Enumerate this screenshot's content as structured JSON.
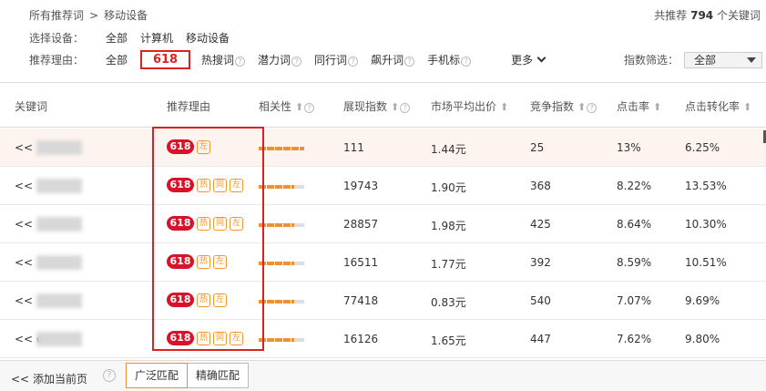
{
  "breadcrumb": {
    "root": "所有推荐词",
    "sep": ">",
    "current": "移动设备"
  },
  "total": {
    "prefix": "共推荐",
    "count": "794",
    "suffix": "个关键词"
  },
  "device": {
    "label": "选择设备：",
    "options": [
      "全部",
      "计算机",
      "移动设备"
    ]
  },
  "reason": {
    "label": "推荐理由：",
    "all": "全部",
    "selected": "618",
    "options": [
      "热搜词",
      "潜力词",
      "同行词",
      "飙升词",
      "手机标"
    ],
    "more": "更多"
  },
  "index_filter": {
    "label": "指数筛选：",
    "value": "全部"
  },
  "columns": [
    "关键词",
    "推荐理由",
    "相关性",
    "展现指数",
    "市场平均出价",
    "竞争指数",
    "点击率",
    "点击转化率"
  ],
  "rows": [
    {
      "kw": "<<",
      "badge": "618",
      "tags": [
        "左"
      ],
      "relevance": 1.0,
      "impressions": "111",
      "bid": "1.44元",
      "competition": "25",
      "ctr": "13%",
      "cvr": "6.25%"
    },
    {
      "kw": "<<",
      "badge": "618",
      "tags": [
        "热",
        "同",
        "左"
      ],
      "relevance": 0.78,
      "impressions": "19743",
      "bid": "1.90元",
      "competition": "368",
      "ctr": "8.22%",
      "cvr": "13.53%"
    },
    {
      "kw": "<<",
      "badge": "618",
      "tags": [
        "热",
        "同",
        "左"
      ],
      "relevance": 0.78,
      "impressions": "28857",
      "bid": "1.98元",
      "competition": "425",
      "ctr": "8.64%",
      "cvr": "10.30%"
    },
    {
      "kw": "<<",
      "badge": "618",
      "tags": [
        "热",
        "左"
      ],
      "relevance": 0.78,
      "impressions": "16511",
      "bid": "1.77元",
      "competition": "392",
      "ctr": "8.59%",
      "cvr": "10.51%"
    },
    {
      "kw": "<<",
      "badge": "618",
      "tags": [
        "热",
        "左"
      ],
      "relevance": 0.78,
      "impressions": "77418",
      "bid": "0.83元",
      "competition": "540",
      "ctr": "7.07%",
      "cvr": "9.69%"
    },
    {
      "kw": "<< e",
      "badge": "618",
      "tags": [
        "热",
        "同",
        "左"
      ],
      "relevance": 0.78,
      "impressions": "16126",
      "bid": "1.65元",
      "competition": "447",
      "ctr": "7.62%",
      "cvr": "9.80%"
    }
  ],
  "footer": {
    "add_label": "添加当前页",
    "broad_match": "广泛匹配",
    "exact_match": "精确匹配"
  },
  "colors": {
    "accent": "#e02020",
    "badge": "#d9122a",
    "tag": "#f29630",
    "highlight_row": "#fdf4ef"
  }
}
